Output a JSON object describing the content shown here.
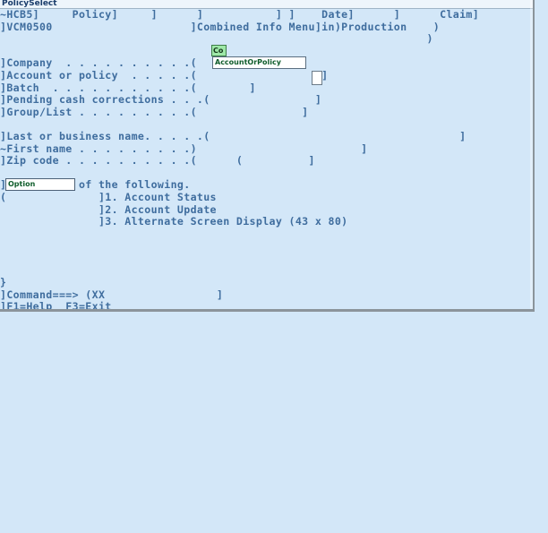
{
  "window": {
    "title": "PolicySelect"
  },
  "screen": {
    "lines": [
      "~HCB5]     Policy]     ]      ]           ] ]    Date]      ]      Claim]           ]",
      "]VCM0500                     ]Combined Info Menu]in)Production    )                 ]",
      "                                                                 )                 ]",
      "",
      "]Company  . . . . . . . . . .(       ]",
      "]Account or policy  . . . . .(                   ]",
      "]Batch  . . . . . . . . . . .(        ]",
      "]Pending cash corrections . . .(                ]",
      "]Group/List . . . . . . . . .(                ]",
      "",
      "]Last or business name. . . . .(                                      ]",
      "~First name . . . . . . . . .)                         ]",
      "]Zip code . . . . . . . . . .(      (          ]",
      "",
      "]Select one of the following.",
      "(              ]1. Account Status",
      "               ]2. Account Update",
      "               ]3. Alternate Screen Display (43 x 80)",
      "",
      "",
      "",
      "",
      "}                                                                                  ]",
      "]Command===> (XX                 ]",
      "]F1=Help  F3=Exit"
    ]
  },
  "fields": {
    "company": {
      "label": "Company",
      "value": "Co"
    },
    "account_or_policy": {
      "label": "Account or policy",
      "value": "AccountOrPolicy"
    },
    "batch": {
      "label": "Batch",
      "value": ""
    },
    "option": {
      "label": "Option",
      "value": "Option"
    }
  },
  "options": [
    {
      "number": "1.",
      "label": "Account Status"
    },
    {
      "number": "2.",
      "label": "Account Update"
    },
    {
      "number": "3.",
      "label": "Alternate Screen Display (43 x 80)"
    }
  ],
  "command_line": {
    "prompt": "Command===>",
    "value": "XX"
  },
  "function_keys": [
    {
      "key": "F1",
      "label": "Help"
    },
    {
      "key": "F3",
      "label": "Exit"
    }
  ],
  "colors": {
    "background": "#d3e7f8",
    "text": "#3f6d9e",
    "title_text": "#1b3d6b",
    "highlight_green": "#9ee8a8",
    "field_text_green": "#0e5c2a",
    "border_gray": "#8b949b"
  }
}
